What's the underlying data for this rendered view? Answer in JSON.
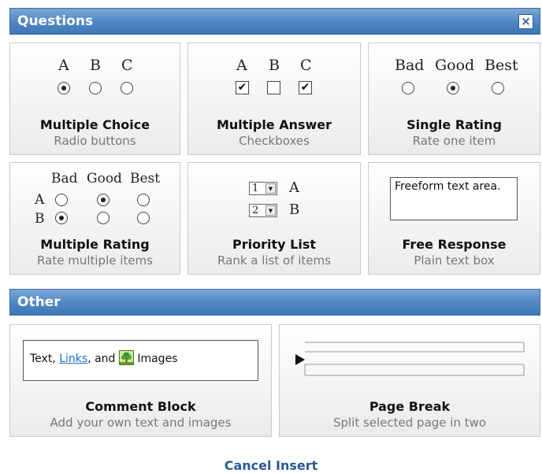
{
  "questions": {
    "title": "Questions",
    "close_label": "×",
    "multiple_choice": {
      "labels": [
        "A",
        "B",
        "C"
      ],
      "title": "Multiple Choice",
      "subtitle": "Radio buttons"
    },
    "multiple_answer": {
      "labels": [
        "A",
        "B",
        "C"
      ],
      "checked": [
        true,
        false,
        true
      ],
      "title": "Multiple Answer",
      "subtitle": "Checkboxes"
    },
    "single_rating": {
      "labels": [
        "Bad",
        "Good",
        "Best"
      ],
      "title": "Single Rating",
      "subtitle": "Rate one item"
    },
    "multiple_rating": {
      "labels": [
        "Bad",
        "Good",
        "Best"
      ],
      "rows": [
        "A",
        "B"
      ],
      "title": "Multiple Rating",
      "subtitle": "Rate multiple items"
    },
    "priority_list": {
      "items": [
        {
          "num": "1",
          "label": "A"
        },
        {
          "num": "2",
          "label": "B"
        }
      ],
      "title": "Priority List",
      "subtitle": "Rank a list of items"
    },
    "free_response": {
      "preview_text": "Freeform text area.",
      "title": "Free Response",
      "subtitle": "Plain text box"
    }
  },
  "other": {
    "title": "Other",
    "comment_block": {
      "preview_text_before": "Text, ",
      "preview_link": "Links",
      "preview_text_middle": ", and ",
      "preview_text_after": " Images",
      "title": "Comment Block",
      "subtitle": "Add your own text and images"
    },
    "page_break": {
      "title": "Page Break",
      "subtitle": "Split selected page in two"
    }
  },
  "footer": {
    "cancel_label": "Cancel Insert"
  },
  "colors": {
    "header_blue": "#4f86c2",
    "link_blue": "#1a6fd6",
    "cancel_blue": "#2c5a96"
  }
}
